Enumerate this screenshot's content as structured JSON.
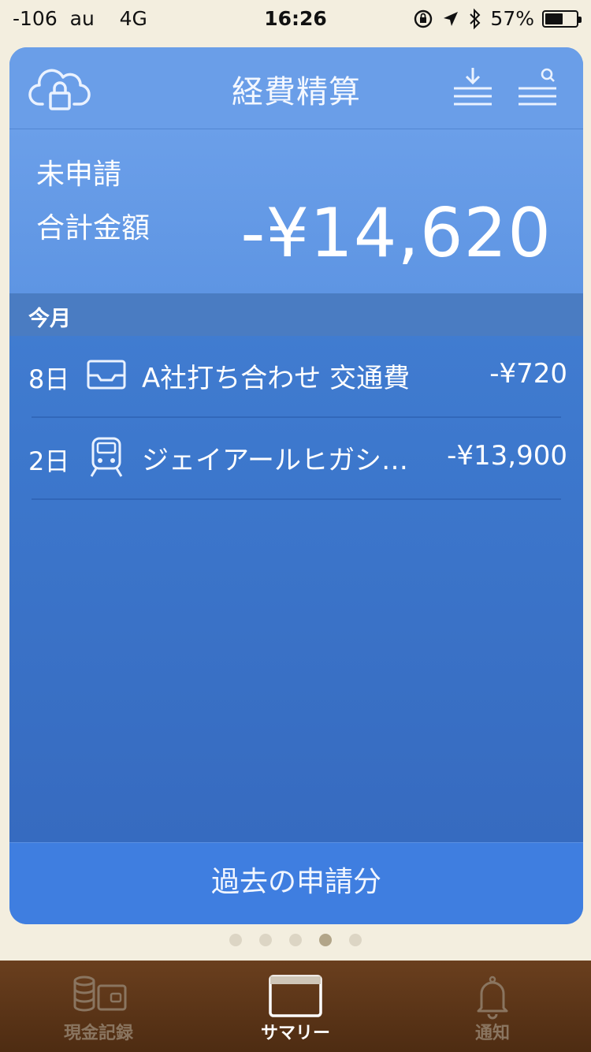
{
  "status_bar": {
    "carrier": "-106  au    4G",
    "time": "16:26",
    "battery_percent": "57%",
    "battery_level": 0.57
  },
  "header": {
    "title": "経費精算",
    "icons": [
      "cloud-lock-icon",
      "download-list-icon",
      "search-list-icon"
    ]
  },
  "summary": {
    "status": "未申請",
    "total_label": "合計金額",
    "total_amount": "-¥14,620"
  },
  "section": {
    "label": "今月"
  },
  "expenses": [
    {
      "day": "8日",
      "icon": "tray-icon",
      "title": "A社打ち合わせ 交通費",
      "amount": "-¥720"
    },
    {
      "day": "2日",
      "icon": "train-icon",
      "title": "ジェイアールヒガシ…",
      "amount": "-¥13,900"
    }
  ],
  "past_button": {
    "label": "過去の申請分"
  },
  "pager": {
    "count": 5,
    "active_index": 3
  },
  "tabs": [
    {
      "label": "現金記録",
      "icon": "coins-wallet-icon",
      "active": false
    },
    {
      "label": "サマリー",
      "icon": "card-icon",
      "active": true
    },
    {
      "label": "通知",
      "icon": "bell-icon",
      "active": false
    }
  ],
  "colors": {
    "background": "#f3eedf",
    "card_header": "#6a9ee8",
    "card_body": "#3d78cd",
    "section_header": "#4a7cc2",
    "past_button": "#3f7ee0",
    "tab_bar": "#5a3415"
  }
}
